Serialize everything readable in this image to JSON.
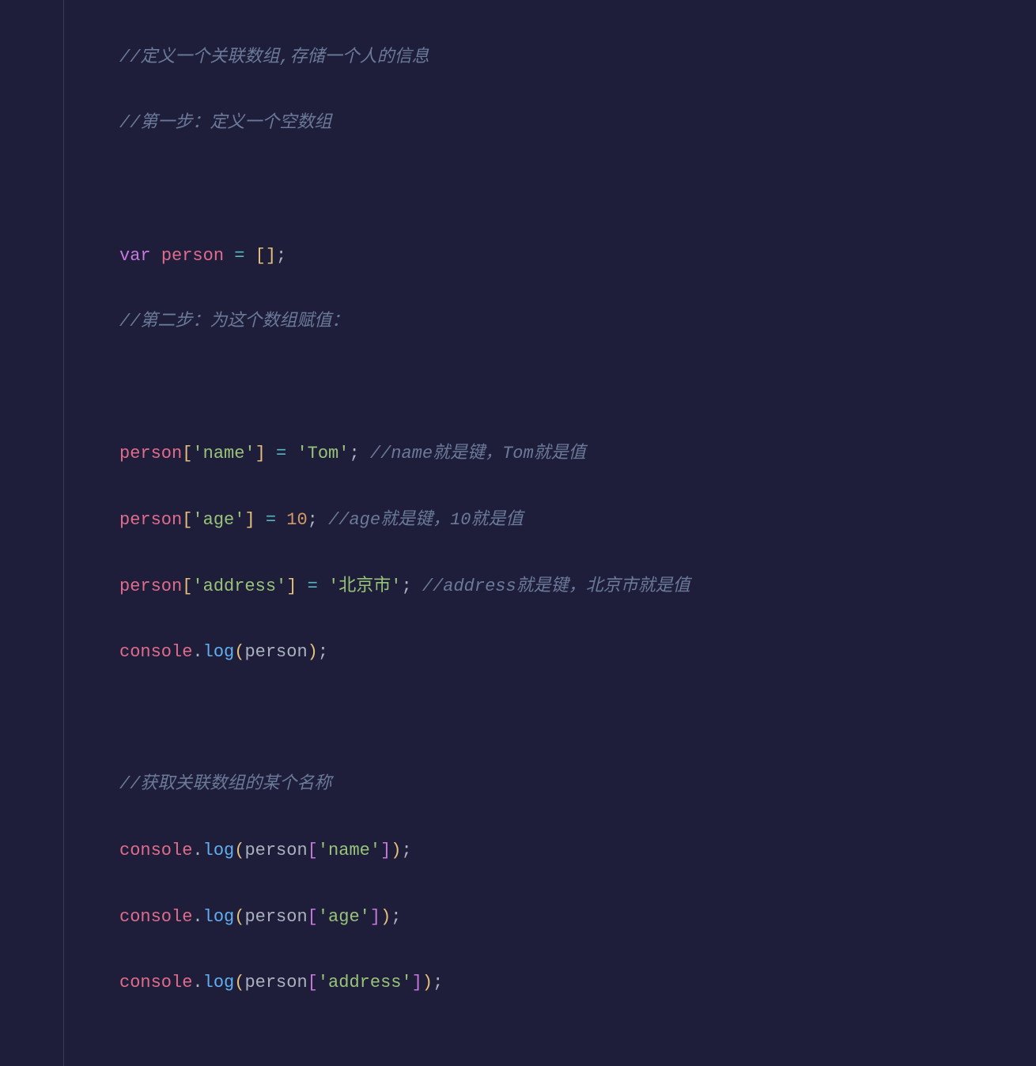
{
  "code": {
    "c1": "//定义一个关联数组,存储一个人的信息",
    "c2": "//第一步：定义一个空数组",
    "kw_var": "var",
    "person": "person",
    "eq": " = ",
    "semi": ";",
    "c3": "//第二步：为这个数组赋值：",
    "key_name": "'name'",
    "val_tom": "'Tom'",
    "c4": "//name就是键，Tom就是值",
    "key_age": "'age'",
    "val_10": "10",
    "c5": "//age就是键，10就是值",
    "key_address": "'address'",
    "val_beijing": "'北京市'",
    "c6": "//address就是键，北京市就是值",
    "console": "console",
    "dot": ".",
    "log": "log",
    "c7": "//获取关联数组的某个名称"
  }
}
